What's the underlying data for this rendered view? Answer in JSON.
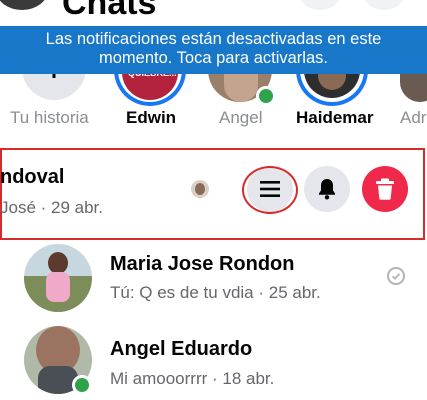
{
  "header": {
    "title": "Chats"
  },
  "banner": {
    "line1": "Las notificaciones están desactivadas en este",
    "line2": "momento. Toca para activarlas."
  },
  "stories": [
    {
      "label": "Tu historia",
      "style": "gray"
    },
    {
      "label": "Edwin",
      "style": "bold",
      "thumb_text": "QUIEBRE..."
    },
    {
      "label": "Angel",
      "style": "gray"
    },
    {
      "label": "Haidemar",
      "style": "bold"
    },
    {
      "label": "Adr",
      "style": "gray"
    }
  ],
  "swiped_chat": {
    "name": "ndoval",
    "message": "José · 29 abr."
  },
  "chats": [
    {
      "name": "Maria Jose Rondon",
      "message": "Tú: Q es de tu vdia · 25 abr.",
      "status": "seen"
    },
    {
      "name": "Angel Eduardo",
      "message": "Mi amooorrrr · 18 abr.",
      "online": true
    }
  ],
  "colors": {
    "banner": "#1877c9",
    "accent_blue": "#1877f2",
    "delete_red": "#f02849",
    "highlight_red": "#d62b2b",
    "online_green": "#31a24c"
  },
  "icons": [
    "plus-icon",
    "menu-icon",
    "bell-icon",
    "trash-icon",
    "seen-check-icon"
  ]
}
